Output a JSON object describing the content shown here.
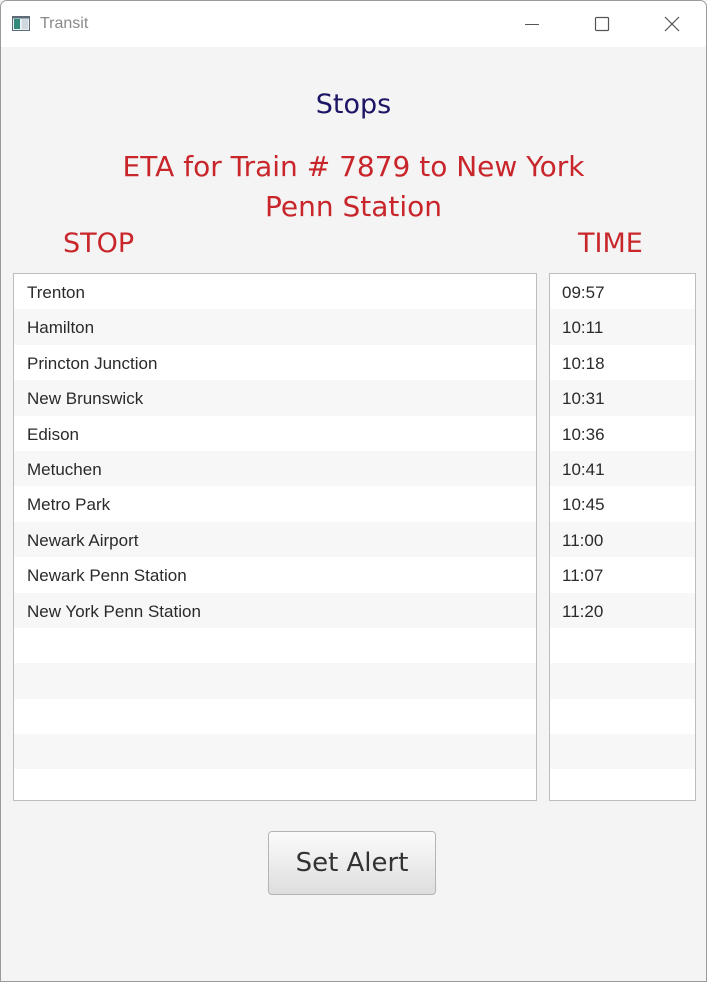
{
  "window": {
    "title": "Transit"
  },
  "content": {
    "stops_title": "Stops",
    "eta_title_line1": "ETA for Train # 7879 to New York",
    "eta_title_line2": "Penn Station",
    "stop_header": "STOP",
    "time_header": "TIME"
  },
  "schedule": {
    "stops": [
      "Trenton",
      "Hamilton",
      "Princton Junction",
      "New Brunswick",
      "Edison",
      "Metuchen",
      "Metro Park",
      "Newark Airport",
      "Newark Penn Station",
      "New York Penn Station",
      "",
      "",
      "",
      "",
      ""
    ],
    "times": [
      "09:57",
      "10:11",
      "10:18",
      "10:31",
      "10:36",
      "10:41",
      "10:45",
      "11:00",
      "11:07",
      "11:20",
      "",
      "",
      "",
      "",
      ""
    ]
  },
  "actions": {
    "set_alert_label": "Set Alert"
  },
  "colors": {
    "title_navy": "#1c1464",
    "accent_red": "#c8262b"
  },
  "icons": {
    "app": "app-window-icon",
    "minimize": "minimize-icon",
    "maximize": "maximize-icon",
    "close": "close-icon"
  }
}
